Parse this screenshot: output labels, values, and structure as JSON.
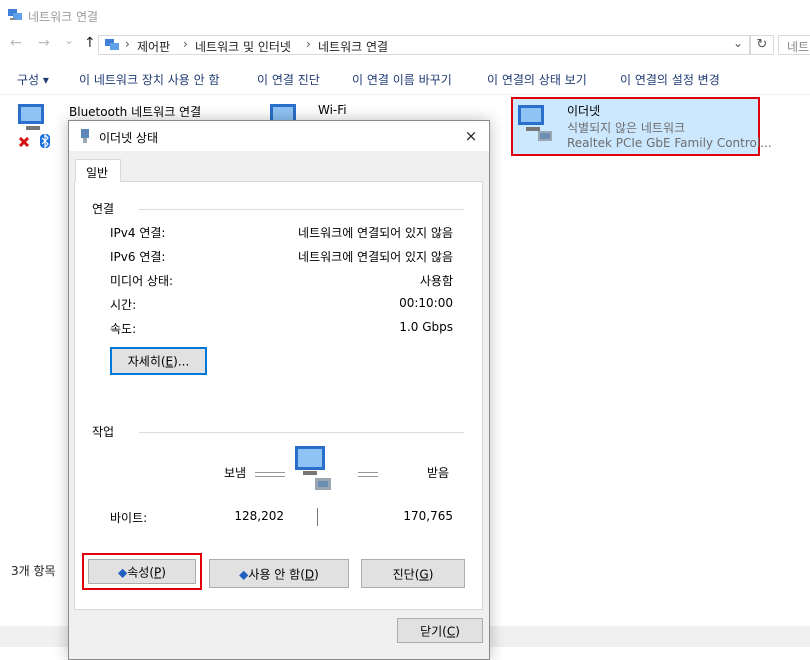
{
  "window": {
    "title": "네트워크 연결"
  },
  "nav": {
    "back": "←",
    "forward": "→",
    "dropdown": "⌄",
    "up": "↑",
    "address": [
      "제어판",
      "네트워크 및 인터넷",
      "네트워크 연결"
    ],
    "separator": "›",
    "address_dropdown": "⌄",
    "refresh": "↻",
    "search_placeholder": "네트"
  },
  "commands": {
    "organize": "구성 ▾",
    "disable": "이 네트워크 장치 사용 안 함",
    "diagnose": "이 연결 진단",
    "rename": "이 연결 이름 바꾸기",
    "view_status": "이 연결의 상태 보기",
    "change_settings": "이 연결의 설정 변경"
  },
  "items": [
    {
      "title": "Bluetooth 네트워크 연결"
    },
    {
      "title": "Wi-Fi"
    },
    {
      "title": "이더넷",
      "status": "식별되지 않은 네트워크",
      "device": "Realtek PCIe GbE Family Control..."
    }
  ],
  "statusbar": {
    "count": "3개 항목"
  },
  "dialog": {
    "title": "이더넷 상태",
    "close": "×",
    "tab": "일반",
    "connection_group": "연결",
    "rows": [
      {
        "label": "IPv4 연결:",
        "value": "네트워크에 연결되어 있지 않음"
      },
      {
        "label": "IPv6 연결:",
        "value": "네트워크에 연결되어 있지 않음"
      },
      {
        "label": "미디어 상태:",
        "value": "사용함"
      },
      {
        "label": "시간:",
        "value": "00:10:00"
      },
      {
        "label": "속도:",
        "value": "1.0 Gbps"
      }
    ],
    "details_button": {
      "text": "자세히(",
      "key": "E",
      "suffix": ")..."
    },
    "activity_group": "작업",
    "sent_label": "보냄",
    "received_label": "받음",
    "bytes_label": "바이트:",
    "bytes_sent": "128,202",
    "bytes_received": "170,765",
    "properties_button": {
      "text": "속성(",
      "key": "P",
      "suffix": ")"
    },
    "disable_button": {
      "text": "사용 안 함(",
      "key": "D",
      "suffix": ")"
    },
    "diagnose_button": {
      "text": "진단(",
      "key": "G",
      "suffix": ")"
    },
    "close_button": {
      "text": "닫기(",
      "key": "C",
      "suffix": ")"
    }
  },
  "colors": {
    "highlight": "#e0000a",
    "selection": "#cce8ff",
    "link": "#1f3b73",
    "focus": "#0078d7"
  }
}
